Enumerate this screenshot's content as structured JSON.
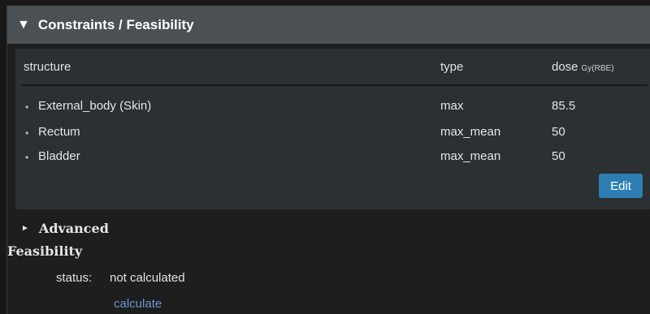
{
  "panel": {
    "title": "Constraints / Feasibility",
    "collapse_icon": "triangle-down-icon"
  },
  "table": {
    "columns": {
      "structure": "structure",
      "type": "type",
      "dose": "dose",
      "dose_unit": "Gy(RBE)"
    },
    "rows": [
      {
        "structure": "External_body (Skin)",
        "type": "max",
        "dose": "85.5"
      },
      {
        "structure": "Rectum",
        "type": "max_mean",
        "dose": "50"
      },
      {
        "structure": "Bladder",
        "type": "max_mean",
        "dose": "50"
      }
    ],
    "edit_label": "Edit"
  },
  "advanced": {
    "label": "Advanced",
    "expand_icon": "triangle-right-icon"
  },
  "feasibility": {
    "title": "Feasibility",
    "status_label": "status:",
    "status_value": "not calculated",
    "calculate_label": "calculate"
  },
  "colors": {
    "header_bg": "#4b5055",
    "table_bg": "#2b3033",
    "accent_button": "#2d7fb3",
    "link": "#6c95c8",
    "background": "#1e1e1e"
  }
}
